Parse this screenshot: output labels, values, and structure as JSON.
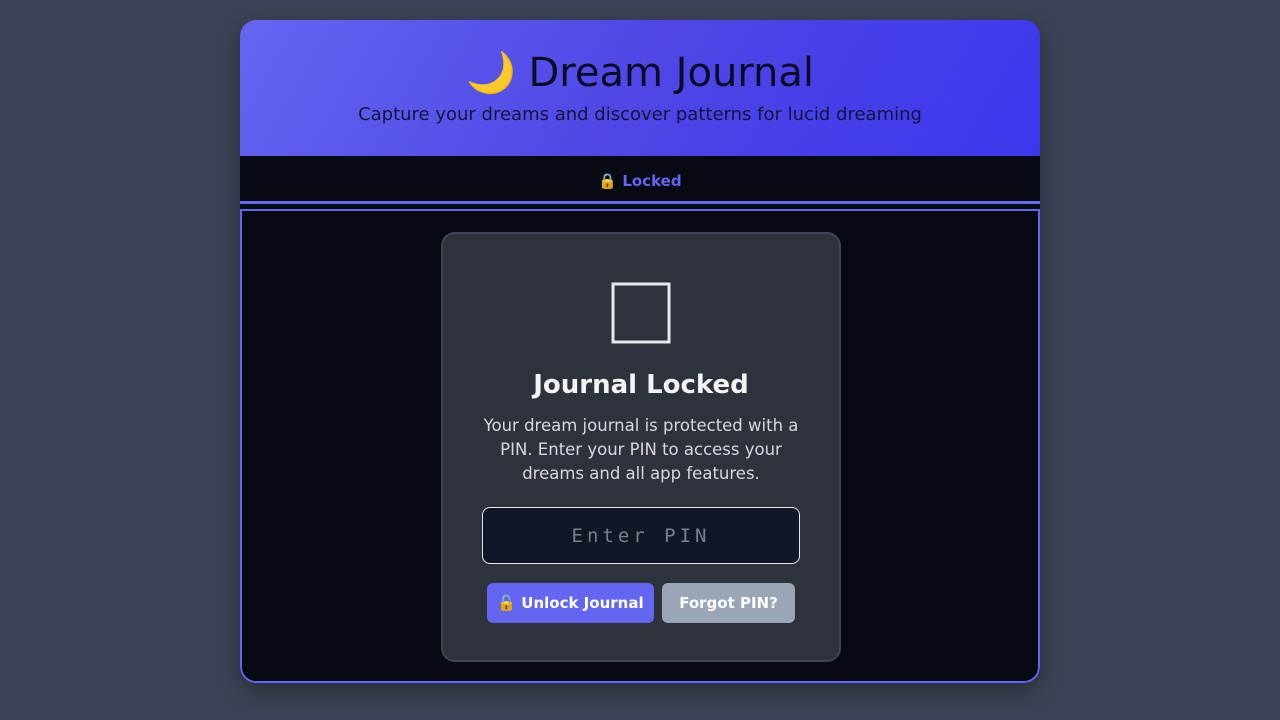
{
  "header": {
    "title": "🌙 Dream Journal",
    "subtitle": "Capture your dreams and discover patterns for lucid dreaming"
  },
  "nav": {
    "tabs": [
      {
        "label": "🔒 Locked",
        "active": true
      }
    ]
  },
  "lock_screen": {
    "icon": "lock-icon",
    "title": "Journal Locked",
    "description": "Your dream journal is protected with a PIN. Enter your PIN to access your dreams and all app features.",
    "pin_input": {
      "value": "",
      "placeholder": "Enter PIN"
    },
    "unlock_label": "🔓 Unlock Journal",
    "forgot_label": "Forgot PIN?"
  },
  "colors": {
    "accent": "#6366f1",
    "page_bg": "#3b4456",
    "app_bg": "#070a12",
    "card_bg": "#2d323b",
    "secondary_button": "#9aa6b6"
  }
}
